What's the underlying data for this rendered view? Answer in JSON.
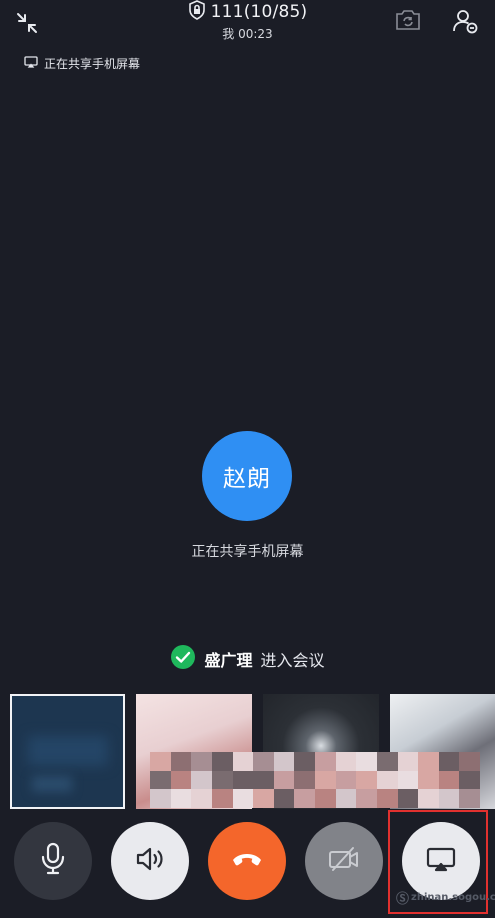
{
  "header": {
    "title": "111(10/85)",
    "timer": "我 00:23"
  },
  "share_tag": {
    "label": "正在共享手机屏幕"
  },
  "participant": {
    "avatar_name": "赵朗",
    "status": "正在共享手机屏幕"
  },
  "join_notice": {
    "name": "盛广理",
    "text": "进入会议"
  },
  "thumbnails": [
    {
      "id": "self"
    },
    {
      "id": "video-2"
    },
    {
      "id": "video-3"
    },
    {
      "id": "video-4"
    }
  ],
  "controls": [
    {
      "id": "mic",
      "icon": "microphone-icon"
    },
    {
      "id": "speaker",
      "icon": "speaker-icon"
    },
    {
      "id": "hangup",
      "icon": "hang-up-icon"
    },
    {
      "id": "camera",
      "icon": "camera-off-icon"
    },
    {
      "id": "share",
      "icon": "screen-share-icon"
    }
  ],
  "watermark": {
    "text": "zhinan.sogou.com"
  },
  "colors": {
    "background": "#1b1d26",
    "avatar": "#2f8ff3",
    "hangup": "#f4662b",
    "check": "#1fb85c",
    "highlight": "#e2312f"
  }
}
